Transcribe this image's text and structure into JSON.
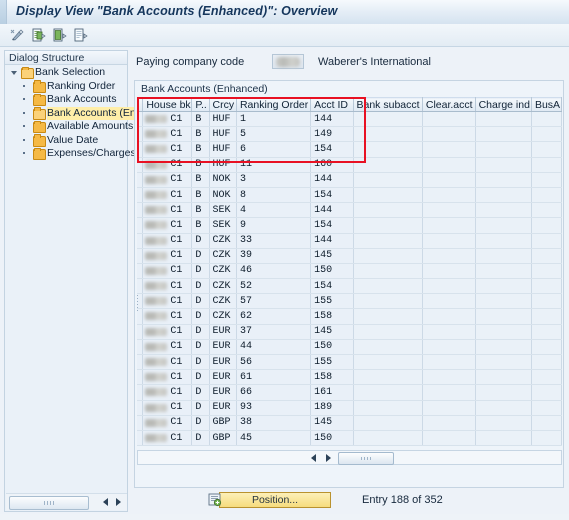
{
  "window": {
    "title": "Display View \"Bank Accounts (Enhanced)\": Overview"
  },
  "toolbar": {
    "buttons": [
      {
        "name": "display-change-icon",
        "title": "Display <-> Change"
      },
      {
        "name": "new-entries-icon",
        "title": "New Entries"
      },
      {
        "name": "copy-as-icon",
        "title": "Copy As..."
      },
      {
        "name": "delete-entry-icon",
        "title": "Delete"
      }
    ]
  },
  "sidebar": {
    "header": "Dialog Structure",
    "items": [
      {
        "label": "Bank Selection",
        "level": 0,
        "expanded": true,
        "selected": false
      },
      {
        "label": "Ranking Order",
        "level": 1,
        "expanded": false,
        "selected": false
      },
      {
        "label": "Bank Accounts",
        "level": 1,
        "expanded": false,
        "selected": false
      },
      {
        "label": "Bank Accounts (Enha",
        "level": 1,
        "expanded": false,
        "selected": true
      },
      {
        "label": "Available Amounts",
        "level": 1,
        "expanded": false,
        "selected": false
      },
      {
        "label": "Value Date",
        "level": 1,
        "expanded": false,
        "selected": false
      },
      {
        "label": "Expenses/Charges",
        "level": 1,
        "expanded": false,
        "selected": false
      }
    ]
  },
  "form": {
    "company_code_label": "Paying company code",
    "company_code_value": "",
    "company_name": "Waberer's International"
  },
  "table": {
    "caption": "Bank Accounts (Enhanced)",
    "columns": [
      {
        "label": "House bk",
        "width": 48
      },
      {
        "label": "P..",
        "width": 18
      },
      {
        "label": "Crcy",
        "width": 30
      },
      {
        "label": "Ranking Order",
        "width": 78
      },
      {
        "label": "Acct ID",
        "width": 55
      },
      {
        "label": "Bank subacct",
        "width": 74
      },
      {
        "label": "Clear.acct",
        "width": 56
      },
      {
        "label": "Charge ind",
        "width": 52
      },
      {
        "label": "BusA",
        "width": 27
      }
    ],
    "rows": [
      {
        "house_bk": "C1",
        "p": "B",
        "crcy": "HUF",
        "ranking_order": "1",
        "acct_id": "144",
        "bank_subacct": "",
        "clear_acct": "",
        "charge_ind": "",
        "busa": ""
      },
      {
        "house_bk": "C1",
        "p": "B",
        "crcy": "HUF",
        "ranking_order": "5",
        "acct_id": "149",
        "bank_subacct": "",
        "clear_acct": "",
        "charge_ind": "",
        "busa": ""
      },
      {
        "house_bk": "C1",
        "p": "B",
        "crcy": "HUF",
        "ranking_order": "6",
        "acct_id": "154",
        "bank_subacct": "",
        "clear_acct": "",
        "charge_ind": "",
        "busa": ""
      },
      {
        "house_bk": "C1",
        "p": "B",
        "crcy": "HUF",
        "ranking_order": "11",
        "acct_id": "160",
        "bank_subacct": "",
        "clear_acct": "",
        "charge_ind": "",
        "busa": ""
      },
      {
        "house_bk": "C1",
        "p": "B",
        "crcy": "NOK",
        "ranking_order": "3",
        "acct_id": "144",
        "bank_subacct": "",
        "clear_acct": "",
        "charge_ind": "",
        "busa": ""
      },
      {
        "house_bk": "C1",
        "p": "B",
        "crcy": "NOK",
        "ranking_order": "8",
        "acct_id": "154",
        "bank_subacct": "",
        "clear_acct": "",
        "charge_ind": "",
        "busa": ""
      },
      {
        "house_bk": "C1",
        "p": "B",
        "crcy": "SEK",
        "ranking_order": "4",
        "acct_id": "144",
        "bank_subacct": "",
        "clear_acct": "",
        "charge_ind": "",
        "busa": ""
      },
      {
        "house_bk": "C1",
        "p": "B",
        "crcy": "SEK",
        "ranking_order": "9",
        "acct_id": "154",
        "bank_subacct": "",
        "clear_acct": "",
        "charge_ind": "",
        "busa": ""
      },
      {
        "house_bk": "C1",
        "p": "D",
        "crcy": "CZK",
        "ranking_order": "33",
        "acct_id": "144",
        "bank_subacct": "",
        "clear_acct": "",
        "charge_ind": "",
        "busa": ""
      },
      {
        "house_bk": "C1",
        "p": "D",
        "crcy": "CZK",
        "ranking_order": "39",
        "acct_id": "145",
        "bank_subacct": "",
        "clear_acct": "",
        "charge_ind": "",
        "busa": ""
      },
      {
        "house_bk": "C1",
        "p": "D",
        "crcy": "CZK",
        "ranking_order": "46",
        "acct_id": "150",
        "bank_subacct": "",
        "clear_acct": "",
        "charge_ind": "",
        "busa": ""
      },
      {
        "house_bk": "C1",
        "p": "D",
        "crcy": "CZK",
        "ranking_order": "52",
        "acct_id": "154",
        "bank_subacct": "",
        "clear_acct": "",
        "charge_ind": "",
        "busa": ""
      },
      {
        "house_bk": "C1",
        "p": "D",
        "crcy": "CZK",
        "ranking_order": "57",
        "acct_id": "155",
        "bank_subacct": "",
        "clear_acct": "",
        "charge_ind": "",
        "busa": ""
      },
      {
        "house_bk": "C1",
        "p": "D",
        "crcy": "CZK",
        "ranking_order": "62",
        "acct_id": "158",
        "bank_subacct": "",
        "clear_acct": "",
        "charge_ind": "",
        "busa": ""
      },
      {
        "house_bk": "C1",
        "p": "D",
        "crcy": "EUR",
        "ranking_order": "37",
        "acct_id": "145",
        "bank_subacct": "",
        "clear_acct": "",
        "charge_ind": "",
        "busa": ""
      },
      {
        "house_bk": "C1",
        "p": "D",
        "crcy": "EUR",
        "ranking_order": "44",
        "acct_id": "150",
        "bank_subacct": "",
        "clear_acct": "",
        "charge_ind": "",
        "busa": ""
      },
      {
        "house_bk": "C1",
        "p": "D",
        "crcy": "EUR",
        "ranking_order": "56",
        "acct_id": "155",
        "bank_subacct": "",
        "clear_acct": "",
        "charge_ind": "",
        "busa": ""
      },
      {
        "house_bk": "C1",
        "p": "D",
        "crcy": "EUR",
        "ranking_order": "61",
        "acct_id": "158",
        "bank_subacct": "",
        "clear_acct": "",
        "charge_ind": "",
        "busa": ""
      },
      {
        "house_bk": "C1",
        "p": "D",
        "crcy": "EUR",
        "ranking_order": "66",
        "acct_id": "161",
        "bank_subacct": "",
        "clear_acct": "",
        "charge_ind": "",
        "busa": ""
      },
      {
        "house_bk": "C1",
        "p": "D",
        "crcy": "EUR",
        "ranking_order": "93",
        "acct_id": "189",
        "bank_subacct": "",
        "clear_acct": "",
        "charge_ind": "",
        "busa": ""
      },
      {
        "house_bk": "C1",
        "p": "D",
        "crcy": "GBP",
        "ranking_order": "38",
        "acct_id": "145",
        "bank_subacct": "",
        "clear_acct": "",
        "charge_ind": "",
        "busa": ""
      },
      {
        "house_bk": "C1",
        "p": "D",
        "crcy": "GBP",
        "ranking_order": "45",
        "acct_id": "150",
        "bank_subacct": "",
        "clear_acct": "",
        "charge_ind": "",
        "busa": ""
      }
    ],
    "highlight": {
      "color": "#e81123",
      "rows": 4,
      "note": "red annotation rectangle over first four HUF rows"
    }
  },
  "footer": {
    "position_button": "Position...",
    "entry_status": "Entry 188 of 352"
  },
  "colors": {
    "title_text": "#15365c",
    "accent_highlight": "#ffeea8",
    "folder": "#f5b945",
    "red_box": "#e81123",
    "button_yellow": "#f6dc7e"
  }
}
